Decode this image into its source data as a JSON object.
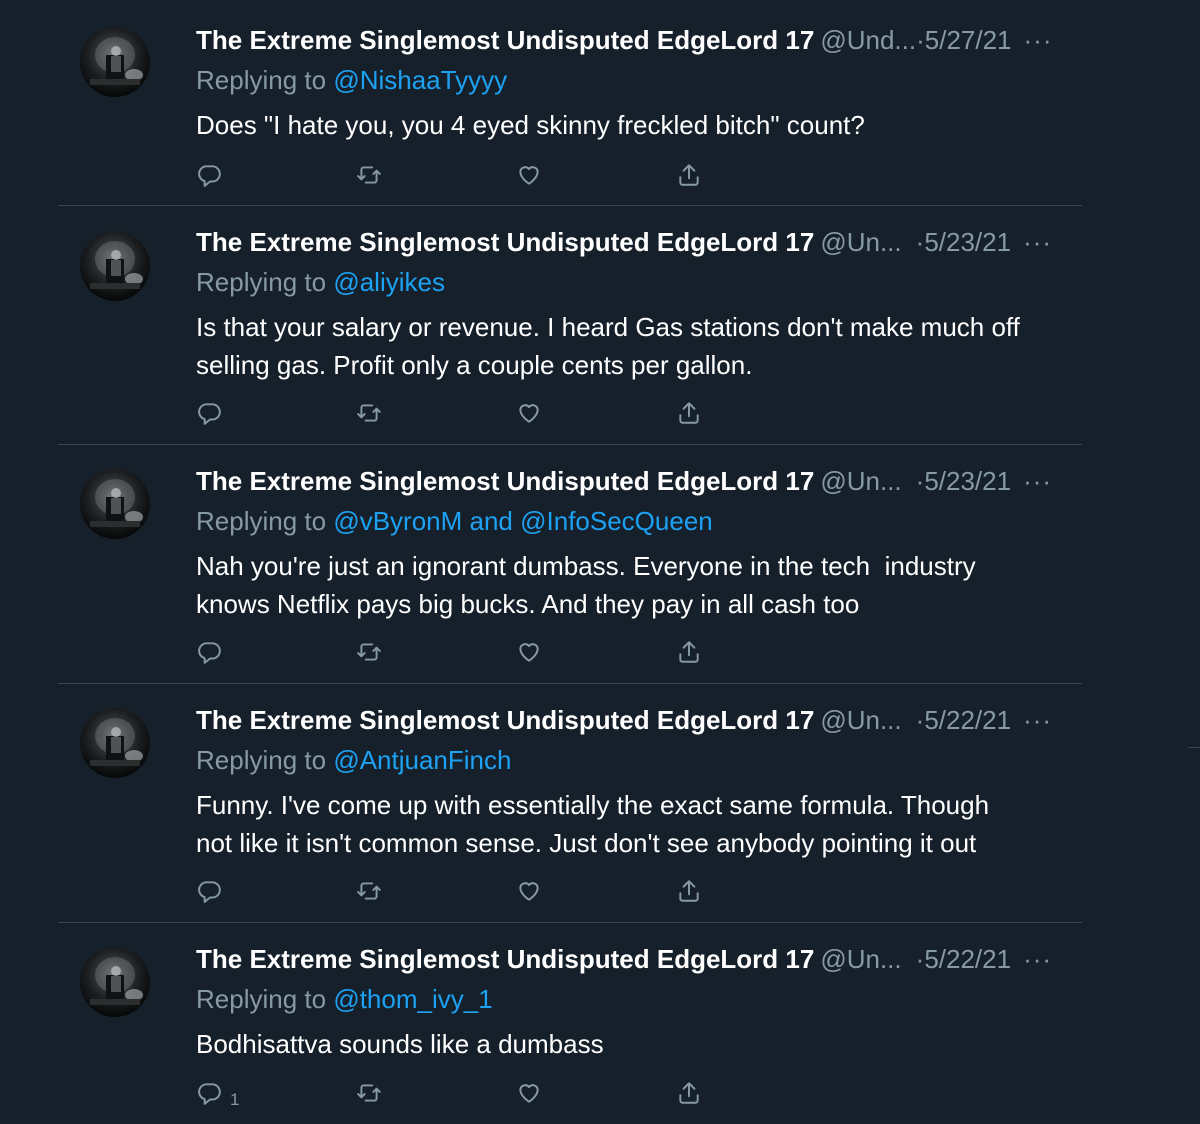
{
  "tweets": [
    {
      "name": "The Extreme Singlemost Undisputed EdgeLord 17",
      "handle": "@Und...",
      "sep": " · ",
      "date": "5/27/21",
      "more": "···",
      "replying_prefix": "Replying to ",
      "mentions": "@NishaaTyyyy",
      "text": "Does \"I hate you, you 4 eyed skinny freckled bitch\" count?",
      "reply_count": ""
    },
    {
      "name": "The Extreme Singlemost Undisputed EdgeLord 17",
      "handle": "@Un...",
      "sep": " ·",
      "date": "5/23/21",
      "more": "···",
      "replying_prefix": "Replying to ",
      "mentions": "@aliyikes",
      "text": "Is that your salary or revenue. I heard Gas stations don't make much off\nselling gas. Profit only a couple cents per gallon.",
      "reply_count": ""
    },
    {
      "name": "The Extreme Singlemost Undisputed EdgeLord 17",
      "handle": "@Un...",
      "sep": " ·",
      "date": "5/23/21",
      "more": "···",
      "replying_prefix": "Replying to ",
      "mentions": "@vByronM and @InfoSecQueen",
      "text": "Nah you're just an ignorant dumbass. Everyone in the tech  industry\nknows Netflix pays big bucks. And they pay in all cash too",
      "reply_count": ""
    },
    {
      "name": "The Extreme Singlemost Undisputed EdgeLord 17",
      "handle": "@Un...",
      "sep": " ·",
      "date": "5/22/21",
      "more": "···",
      "replying_prefix": "Replying to ",
      "mentions": "@AntjuanFinch",
      "text": "Funny. I've come up with essentially the exact same formula. Though\nnot like it isn't common sense. Just don't see anybody pointing it out",
      "reply_count": ""
    },
    {
      "name": "The Extreme Singlemost Undisputed EdgeLord 17",
      "handle": "@Un...",
      "sep": " ·",
      "date": "5/22/21",
      "more": "···",
      "replying_prefix": "Replying to ",
      "mentions": "@thom_ivy_1",
      "text": "Bodhisattva sounds like a dumbass",
      "reply_count": "1"
    }
  ],
  "icons": {
    "reply": "reply-icon",
    "retweet": "retweet-icon",
    "like": "like-icon",
    "share": "share-icon"
  },
  "colors": {
    "background": "#15202b",
    "divider": "#38444d",
    "secondary_text": "#8899a6",
    "link": "#1da1f2",
    "primary_text": "#ffffff"
  }
}
